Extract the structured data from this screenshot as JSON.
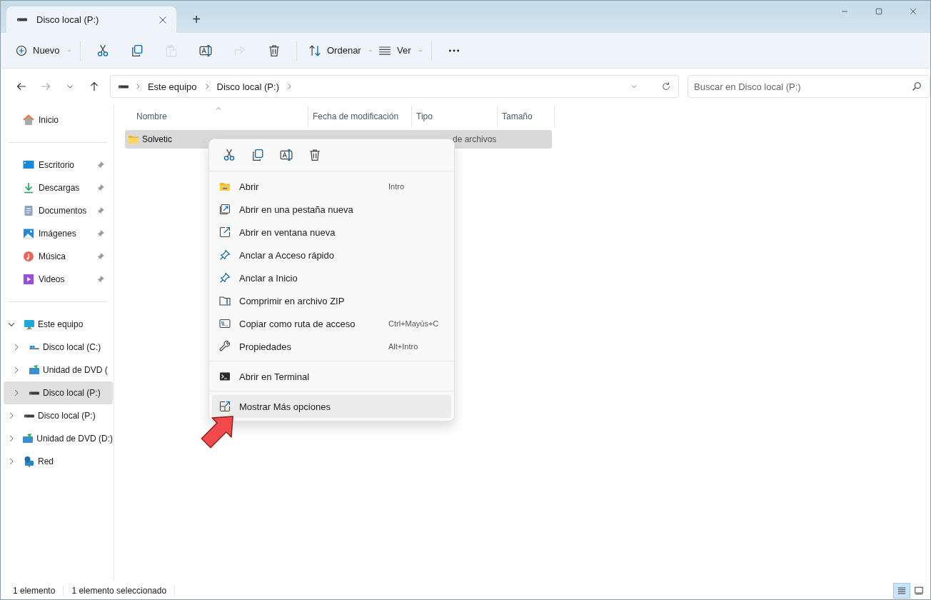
{
  "window": {
    "tab": {
      "title": "Disco local (P:)",
      "selected": true
    },
    "new_tab": "+"
  },
  "toolbar": {
    "new": "Nuevo",
    "sort": "Ordenar",
    "view": "Ver",
    "actions": [
      {
        "kind": "cut",
        "disabled": false
      },
      {
        "kind": "copy",
        "disabled": false
      },
      {
        "kind": "paste",
        "disabled": true
      },
      {
        "kind": "rename",
        "disabled": false
      },
      {
        "kind": "share",
        "disabled": true
      },
      {
        "kind": "delete",
        "disabled": false
      }
    ]
  },
  "address": {
    "path": [
      "Este equipo",
      "Disco local (P:)"
    ],
    "search_placeholder": "Buscar en Disco local (P:)"
  },
  "sidebar": {
    "home": "Inicio",
    "quick_access": [
      {
        "label": "Escritorio",
        "kind": "desktop",
        "pinned": true
      },
      {
        "label": "Descargas",
        "kind": "download",
        "pinned": true
      },
      {
        "label": "Documentos",
        "kind": "documents",
        "pinned": true
      },
      {
        "label": "Imágenes",
        "kind": "pictures",
        "pinned": true
      },
      {
        "label": "Música",
        "kind": "music",
        "pinned": true
      },
      {
        "label": "Videos",
        "kind": "videos",
        "pinned": true
      }
    ],
    "tree": [
      {
        "label": "Este equipo",
        "kind": "pc",
        "expanded": true,
        "selected": false,
        "children": [
          {
            "label": "Disco local (C:)",
            "kind": "windrive",
            "expanded": false,
            "selected": false
          },
          {
            "label": "Unidad de DVD (",
            "kind": "dvd",
            "expanded": false,
            "selected": false
          },
          {
            "label": "Disco local (P:)",
            "kind": "drive",
            "expanded": false,
            "selected": true
          }
        ]
      },
      {
        "label": "Disco local (P:)",
        "kind": "drive",
        "expanded": false,
        "selected": false
      },
      {
        "label": "Unidad de DVD (D:)",
        "kind": "dvd",
        "expanded": false,
        "selected": false
      },
      {
        "label": "Red",
        "kind": "network",
        "expanded": false,
        "selected": false
      }
    ]
  },
  "table": {
    "columns": [
      "Nombre",
      "Fecha de modificación",
      "Tipo",
      "Tamaño"
    ],
    "rows": [
      {
        "name": "Solvetic",
        "type": "de archivos",
        "selected": true
      }
    ]
  },
  "context_menu": {
    "actions": [
      {
        "kind": "cut"
      },
      {
        "kind": "copy"
      },
      {
        "kind": "rename"
      },
      {
        "kind": "delete"
      }
    ],
    "sections": [
      [
        {
          "label": "Abrir",
          "shortcut": "Intro",
          "kind": "open",
          "selected": false
        },
        {
          "label": "Abrir en una pestaña nueva",
          "kind": "newtab",
          "selected": false
        },
        {
          "label": "Abrir en ventana nueva",
          "kind": "newwindow",
          "selected": false
        },
        {
          "label": "Anclar a Acceso rápido",
          "kind": "pin",
          "selected": false
        },
        {
          "label": "Anclar a Inicio",
          "kind": "pin",
          "selected": false
        },
        {
          "label": "Comprimir en archivo ZIP",
          "kind": "zip",
          "selected": false
        },
        {
          "label": "Copiar como ruta de acceso",
          "shortcut": "Ctrl+Mayús+C",
          "kind": "path",
          "selected": false
        },
        {
          "label": "Propiedades",
          "shortcut": "Alt+Intro",
          "kind": "properties",
          "selected": false
        }
      ],
      [
        {
          "label": "Abrir en Terminal",
          "kind": "terminal",
          "selected": false
        }
      ],
      [
        {
          "label": "Mostrar Más opciones",
          "kind": "more",
          "selected": true
        }
      ]
    ]
  },
  "status_bar": {
    "items": [
      "1 elemento",
      "1 elemento seleccionado"
    ],
    "views": [
      {
        "kind": "details",
        "selected": true
      },
      {
        "kind": "tiles",
        "selected": false
      }
    ]
  }
}
